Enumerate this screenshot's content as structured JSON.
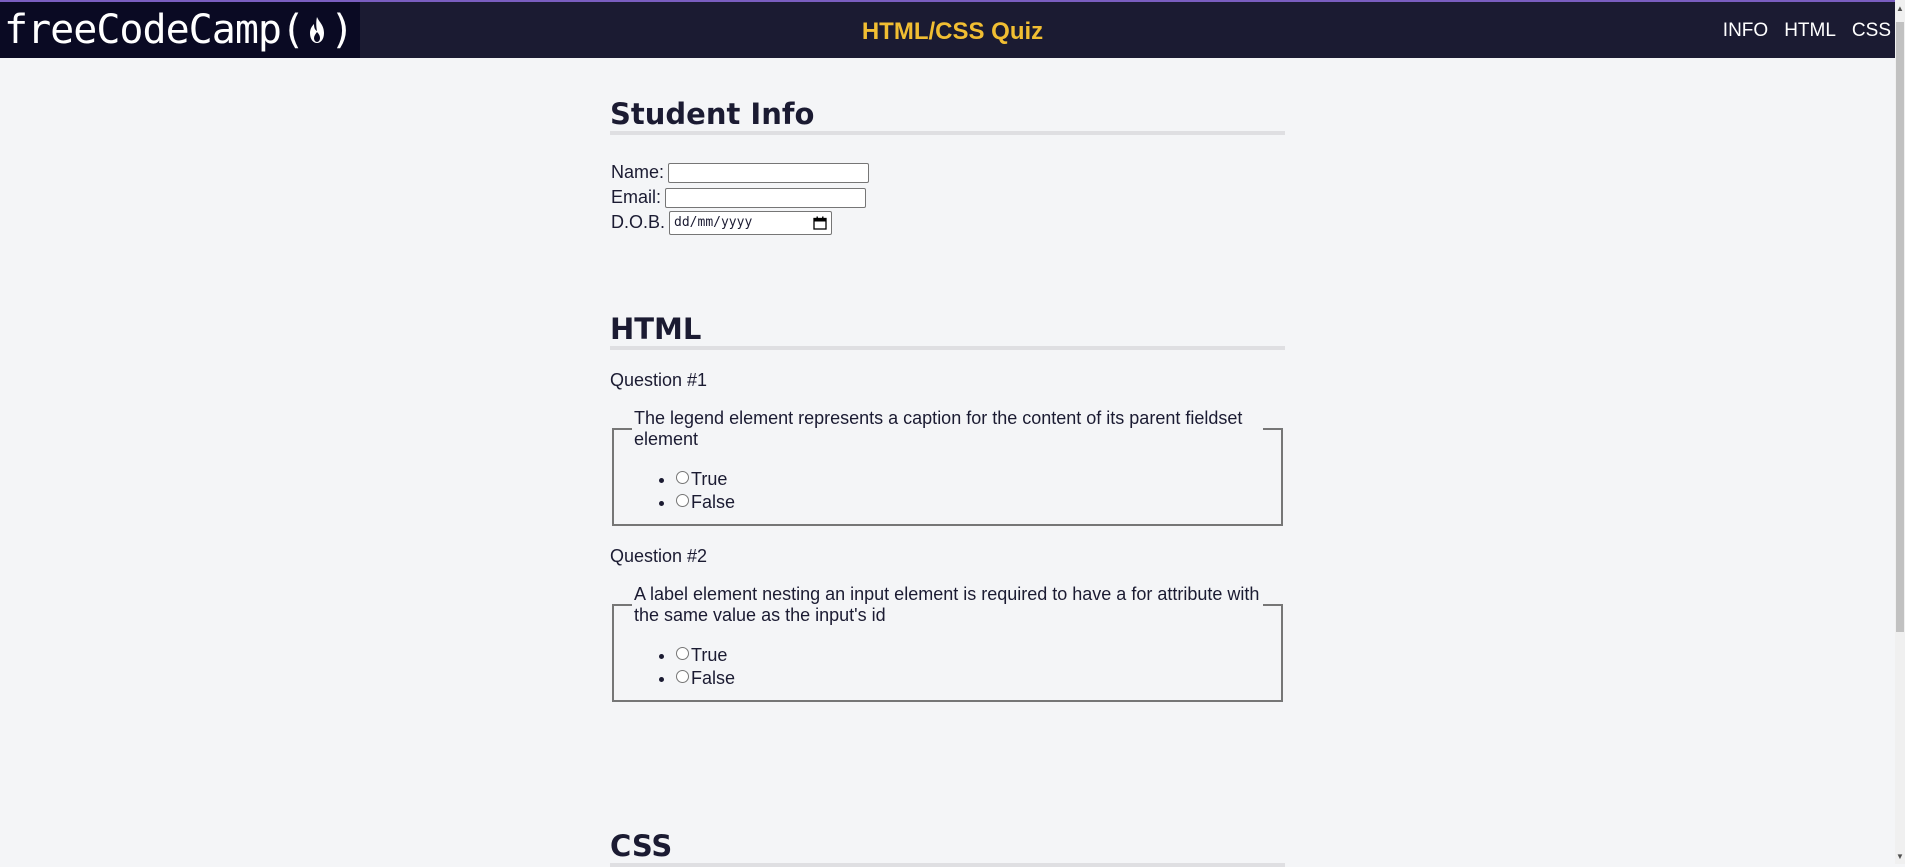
{
  "header": {
    "logo_text": "freeCodeCamp",
    "logo_paren_open": "(",
    "logo_paren_close": ")",
    "title": "HTML/CSS Quiz",
    "nav": [
      "INFO",
      "HTML",
      "CSS"
    ]
  },
  "student_info": {
    "heading": "Student Info",
    "name_label": "Name:",
    "name_value": "",
    "email_label": "Email:",
    "email_value": "",
    "dob_label": "D.O.B.",
    "dob_placeholder": "dd/mm/yyyy"
  },
  "html_section": {
    "heading": "HTML",
    "questions": [
      {
        "label": "Question #1",
        "text": "The legend element represents a caption for the content of its parent fieldset element",
        "options": [
          "True",
          "False"
        ]
      },
      {
        "label": "Question #2",
        "text": "A label element nesting an input element is required to have a for attribute with the same value as the input's id",
        "options": [
          "True",
          "False"
        ]
      }
    ]
  },
  "css_section": {
    "heading": "CSS"
  },
  "colors": {
    "topbar": "#1b1b32",
    "logo_bg": "#0a0a23",
    "accent_title": "#f1be32",
    "page_bg": "#f4f5f7"
  },
  "icons": {
    "logo": "flame-icon",
    "date_picker": "calendar-icon"
  }
}
